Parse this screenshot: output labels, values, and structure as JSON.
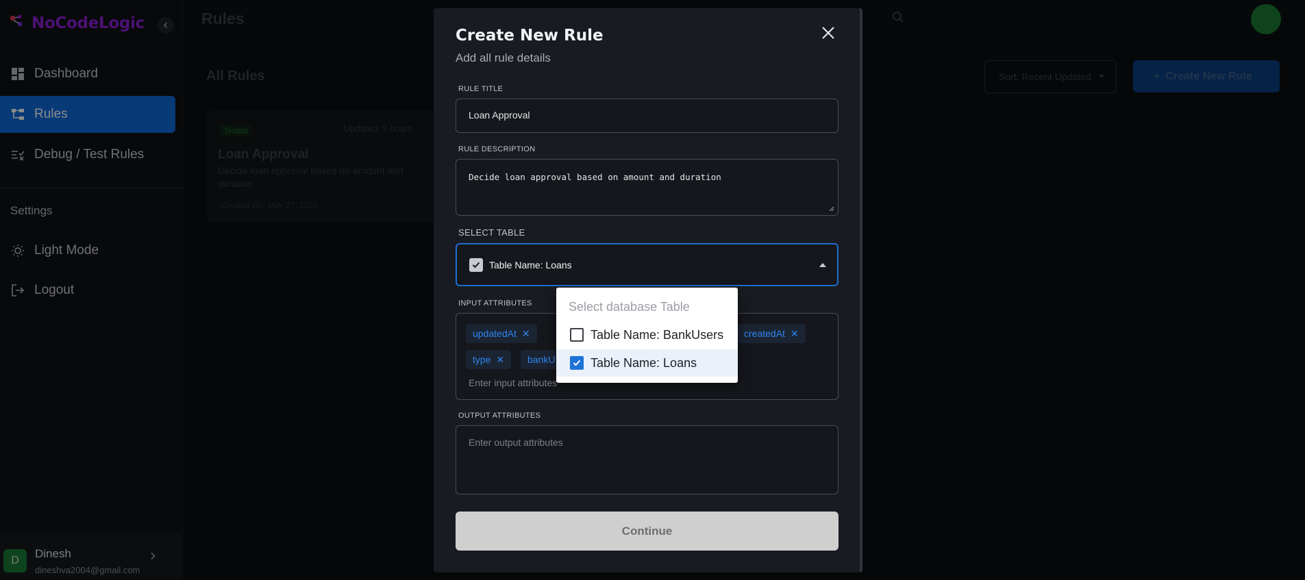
{
  "sidebar": {
    "brand": "NoCodeLogic",
    "nav": [
      {
        "label": "Dashboard",
        "icon": "dashboard-icon"
      },
      {
        "label": "Rules",
        "icon": "rules-icon",
        "active": true
      },
      {
        "label": "Debug / Test Rules",
        "icon": "debug-icon"
      }
    ],
    "settings_label": "Settings",
    "settings": [
      {
        "label": "Light Mode",
        "icon": "sun-icon"
      },
      {
        "label": "Logout",
        "icon": "logout-icon"
      }
    ],
    "user": {
      "initial": "D",
      "name": "Dinesh",
      "email": "dineshva2004@gmail.com"
    }
  },
  "header": {
    "title": "Rules"
  },
  "main": {
    "heading": "All Rules",
    "sort_label": "Sort: Recent Updated",
    "create_label": "Create New Rule",
    "card": {
      "badge": "Tested",
      "updated": "Updated: 9 hours",
      "title": "Loan Approval",
      "description": "Decide loan approval based on amount and duration",
      "created": "Created On: May 27, 2025"
    }
  },
  "modal": {
    "title": "Create New Rule",
    "subtitle": "Add all rule details",
    "rule_title_label": "RULE TITLE",
    "rule_title_value": "Loan Approval",
    "rule_description_label": "RULE DESCRIPTION",
    "rule_description_value": "Decide loan approval based on amount and duration",
    "select_table_label": "SELECT TABLE",
    "select_table_value": "Table Name: Loans",
    "input_attributes_label": "INPUT ATTRIBUTES",
    "input_chips": [
      "updatedAt",
      "createdAt",
      "type",
      "bankU"
    ],
    "input_placeholder": "Enter input attributes",
    "output_attributes_label": "OUTPUT ATTRIBUTES",
    "output_placeholder": "Enter output attributes",
    "continue_label": "Continue"
  },
  "dropdown": {
    "placeholder": "Select database Table",
    "options": [
      {
        "label": "Table Name: BankUsers",
        "checked": false
      },
      {
        "label": "Table Name: Loans",
        "checked": true
      }
    ]
  },
  "colors": {
    "accent": "#0e6ad9",
    "brand": "#8b1fd1",
    "chip_text": "#2f86f0",
    "avatar": "#1c7a35"
  }
}
